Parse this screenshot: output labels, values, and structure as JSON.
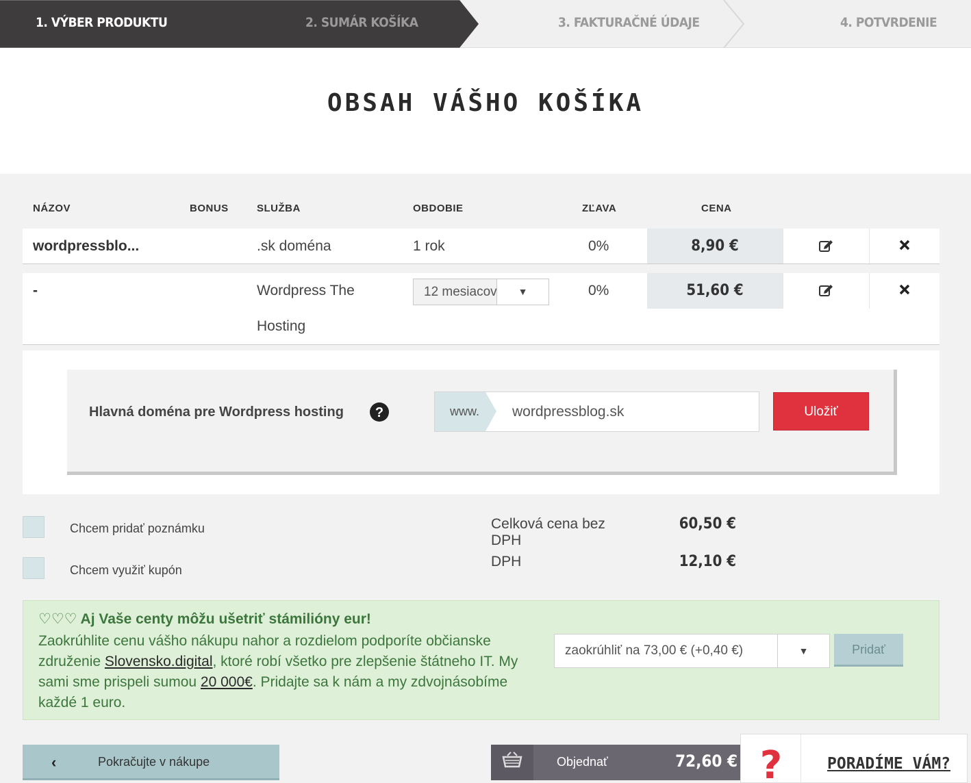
{
  "steps": [
    {
      "label": "1. VÝBER PRODUKTU",
      "active": true
    },
    {
      "label": "2. SUMÁR KOŠÍKA",
      "active": false
    },
    {
      "label": "3. FAKTURAČNÉ ÚDAJE",
      "active": false
    },
    {
      "label": "4. POTVRDENIE",
      "active": false
    }
  ],
  "page_title": "OBSAH VÁŠHO KOŠÍKA",
  "table": {
    "headers": {
      "name": "NÁZOV",
      "bonus": "BONUS",
      "service": "SLUŽBA",
      "period": "OBDOBIE",
      "discount": "ZĽAVA",
      "price": "CENA"
    },
    "rows": [
      {
        "name": "wordpressblo...",
        "service": ".sk doména",
        "period": "1 rok",
        "discount": "0%",
        "price": "8,90 €"
      },
      {
        "name": "-",
        "service_line1": "Wordpress The",
        "service_line2": "Hosting",
        "period_select": "12 mesiacov",
        "discount": "0%",
        "price": "51,60 €"
      }
    ],
    "icons": {
      "edit": "edit-icon",
      "remove": "close-icon"
    }
  },
  "domain_panel": {
    "label": "Hlavná doména pre Wordpress hosting",
    "prefix": "www.",
    "value": "wordpressblog.sk",
    "save_label": "Uložiť"
  },
  "options": {
    "note_label": "Chcem pridať poznámku",
    "coupon_label": "Chcem využiť kupón"
  },
  "summary": {
    "net_label_line1": "Celková cena bez",
    "net_label_line2": "DPH",
    "net_value": "60,50 €",
    "vat_label": "DPH",
    "vat_value": "12,10 €"
  },
  "donation": {
    "hearts": "♡♡♡",
    "headline": "Aj Vaše centy môžu ušetriť stámilióny eur!",
    "text_1": "Zaokrúhlite cenu vášho nákupu nahor a rozdielom podporíte občianske združenie ",
    "link_1": "Slovensko.digital",
    "text_2": ", ktoré robí všetko pre zlepšenie štátneho IT. My sami sme prispeli sumou ",
    "link_2": "20 000€",
    "text_3": ". Pridajte sa k nám a my zdvojnásobíme každé 1 euro.",
    "select_value": "zaokrúhliť na 73,00 € (+0,40 €)",
    "add_label": "Pridať"
  },
  "footer": {
    "continue_label": "Pokračujte v nákupe",
    "order_label": "Objednať",
    "order_total": "72,60 €",
    "help_label": "PORADÍME VÁM?"
  },
  "colors": {
    "active_step": "#3f3c3e",
    "save_button": "#e0313e",
    "green_panel": "#dff0d8",
    "green_text": "#3c763d",
    "order_button": "#6b6770",
    "continue_button": "#a9c7ca",
    "help_icon": "#e0313e"
  }
}
